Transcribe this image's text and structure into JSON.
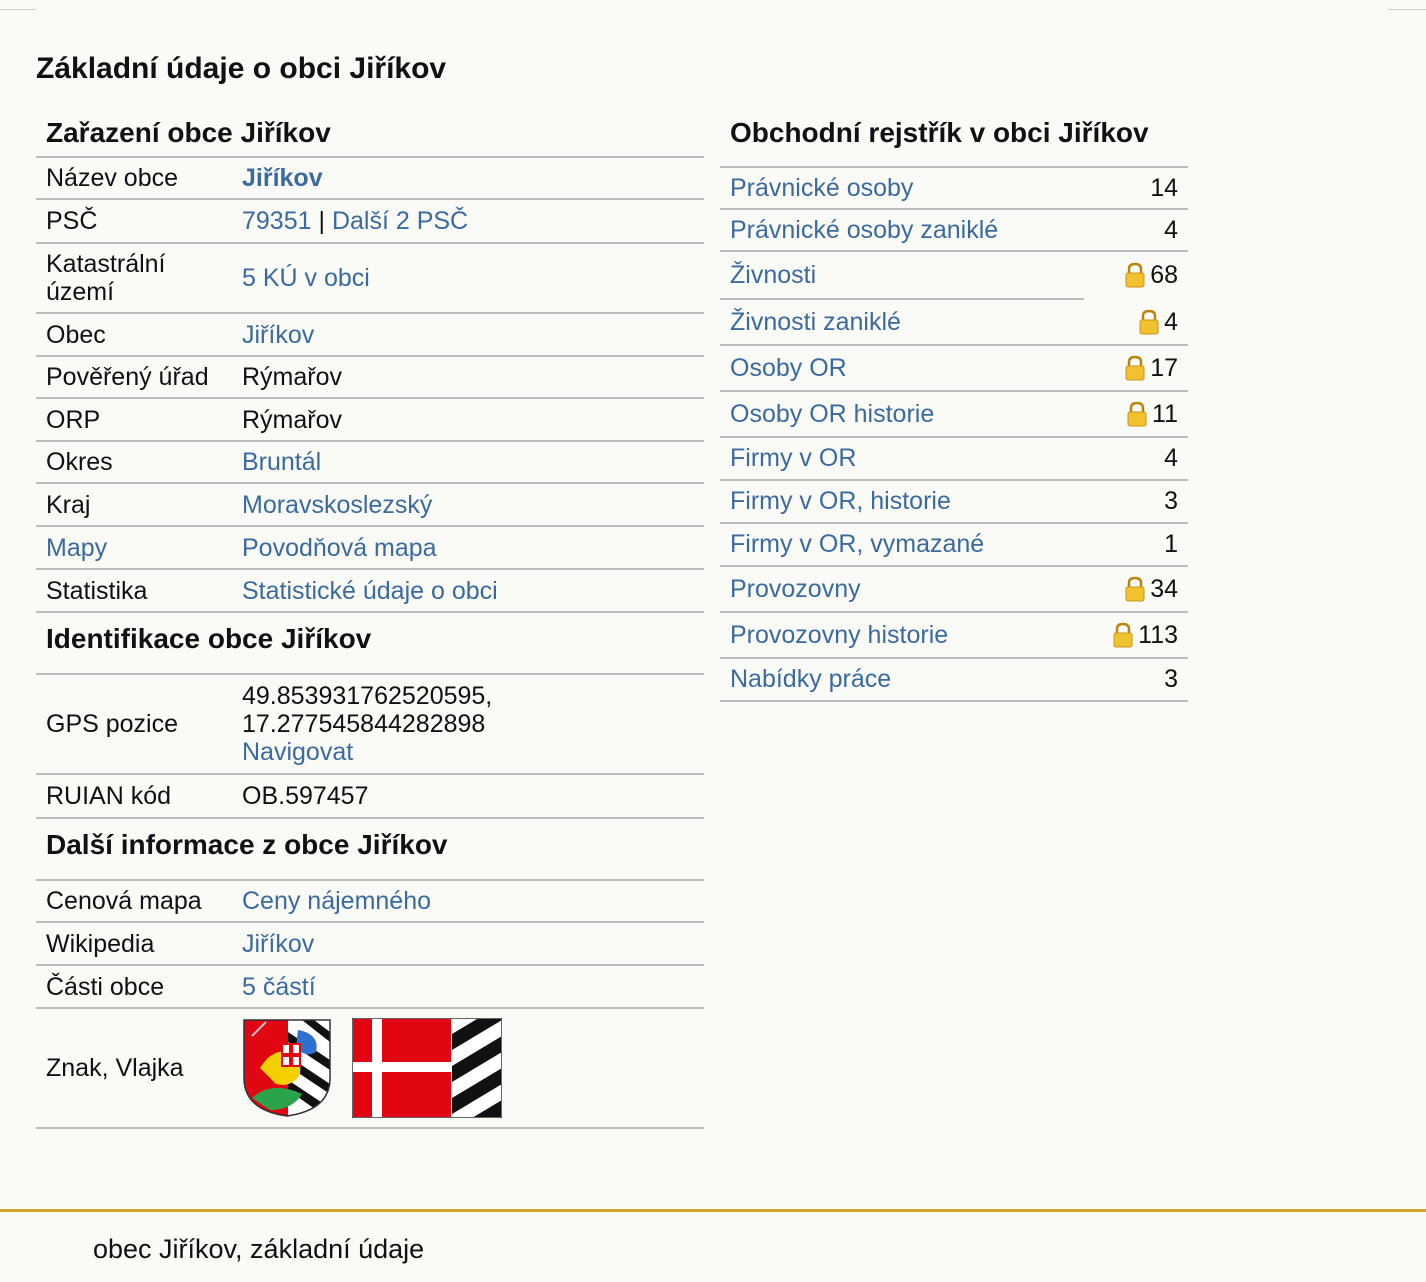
{
  "page_title": "Základní údaje o obci Jiříkov",
  "zarazeni": {
    "title": "Zařazení obce Jiříkov",
    "nazev_label": "Název obce",
    "nazev_value": "Jiříkov",
    "psc_label": "PSČ",
    "psc_value": "79351",
    "psc_sep": "|",
    "psc_more": "Další 2 PSČ",
    "katastr_label": "Katastrální území",
    "katastr_value": "5 KÚ v obci",
    "obec_label": "Obec",
    "obec_value": "Jiříkov",
    "poverene_label": "Pověřený úřad",
    "poverene_value": "Rýmařov",
    "orp_label": "ORP",
    "orp_value": "Rýmařov",
    "okres_label": "Okres",
    "okres_value": "Bruntál",
    "kraj_label": "Kraj",
    "kraj_value": "Moravskoslezský",
    "mapy_label": "Mapy",
    "mapy_value": "Povodňová mapa",
    "statistika_label": "Statistika",
    "statistika_value": "Statistické údaje o obci"
  },
  "identifikace": {
    "title": "Identifikace obce Jiříkov",
    "gps_label": "GPS pozice",
    "gps_lat": "49.853931762520595,",
    "gps_lon": "17.277545844282898",
    "gps_nav": "Navigovat",
    "ruian_label": "RUIAN kód",
    "ruian_value": "OB.597457"
  },
  "dalsi": {
    "title": "Další informace z obce Jiříkov",
    "cenova_label": "Cenová mapa",
    "cenova_value": "Ceny nájemného",
    "wiki_label": "Wikipedia",
    "wiki_value": "Jiříkov",
    "casti_label": "Části obce",
    "casti_value": "5 částí",
    "znak_label": "Znak, Vlajka"
  },
  "rejstrik": {
    "title": "Obchodní rejstřík v obci Jiříkov",
    "items": [
      {
        "label": "Právnické osoby",
        "count": "14",
        "locked": false
      },
      {
        "label": "Právnické osoby zaniklé",
        "count": "4",
        "locked": false
      },
      {
        "label": "Živnosti",
        "count": "68",
        "locked": true
      },
      {
        "label": "Živnosti zaniklé",
        "count": "4",
        "locked": true
      },
      {
        "label": "Osoby OR",
        "count": "17",
        "locked": true
      },
      {
        "label": "Osoby OR historie",
        "count": "11",
        "locked": true
      },
      {
        "label": "Firmy v OR",
        "count": "4",
        "locked": false
      },
      {
        "label": "Firmy v OR, historie",
        "count": "3",
        "locked": false
      },
      {
        "label": "Firmy v OR, vymazané",
        "count": "1",
        "locked": false
      },
      {
        "label": "Provozovny",
        "count": "34",
        "locked": true
      },
      {
        "label": "Provozovny historie",
        "count": "113",
        "locked": true
      },
      {
        "label": "Nabídky práce",
        "count": "3",
        "locked": false
      }
    ]
  },
  "colors": {
    "link": "#3a6a9e",
    "border": "#bdbdbd",
    "footer_accent": "#d2a628",
    "flag_red": "#e20613"
  },
  "footer_text": "obec Jiříkov, základní údaje"
}
